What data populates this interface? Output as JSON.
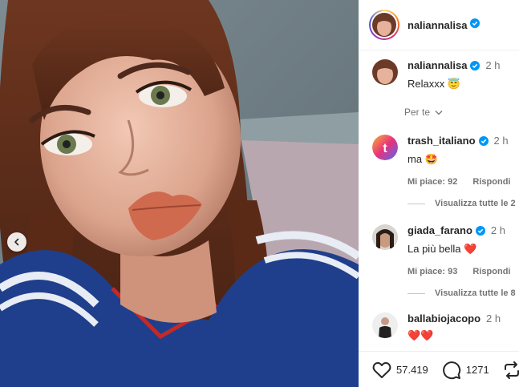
{
  "post": {
    "username": "naliannalisa",
    "caption": "Relaxxx 😇",
    "caption_time": "2 h",
    "sort_label": "Per te"
  },
  "comments": [
    {
      "username": "trash_italiano",
      "time": "2 h",
      "text": "ma 🤩",
      "likes": "Mi piace: 92",
      "reply": "Rispondi",
      "view_all": "Visualizza tutte le 2"
    },
    {
      "username": "giada_farano",
      "time": "2 h",
      "text": "La più bella ❤️",
      "likes": "Mi piace: 93",
      "reply": "Rispondi",
      "view_all": "Visualizza tutte le 8"
    },
    {
      "username": "ballabiojacopo",
      "time": "2 h",
      "text": "❤️❤️"
    }
  ],
  "actions": {
    "likes": "57.419",
    "comments": "1271"
  },
  "icons": {
    "verified": "verified-badge-icon",
    "prev": "chevron-left-icon",
    "like": "heart-icon",
    "comment": "comment-icon",
    "repost": "repost-icon"
  },
  "colors": {
    "verified": "#0095f6",
    "text": "#262626",
    "secondary": "#737373",
    "heart": "#ed4956"
  }
}
